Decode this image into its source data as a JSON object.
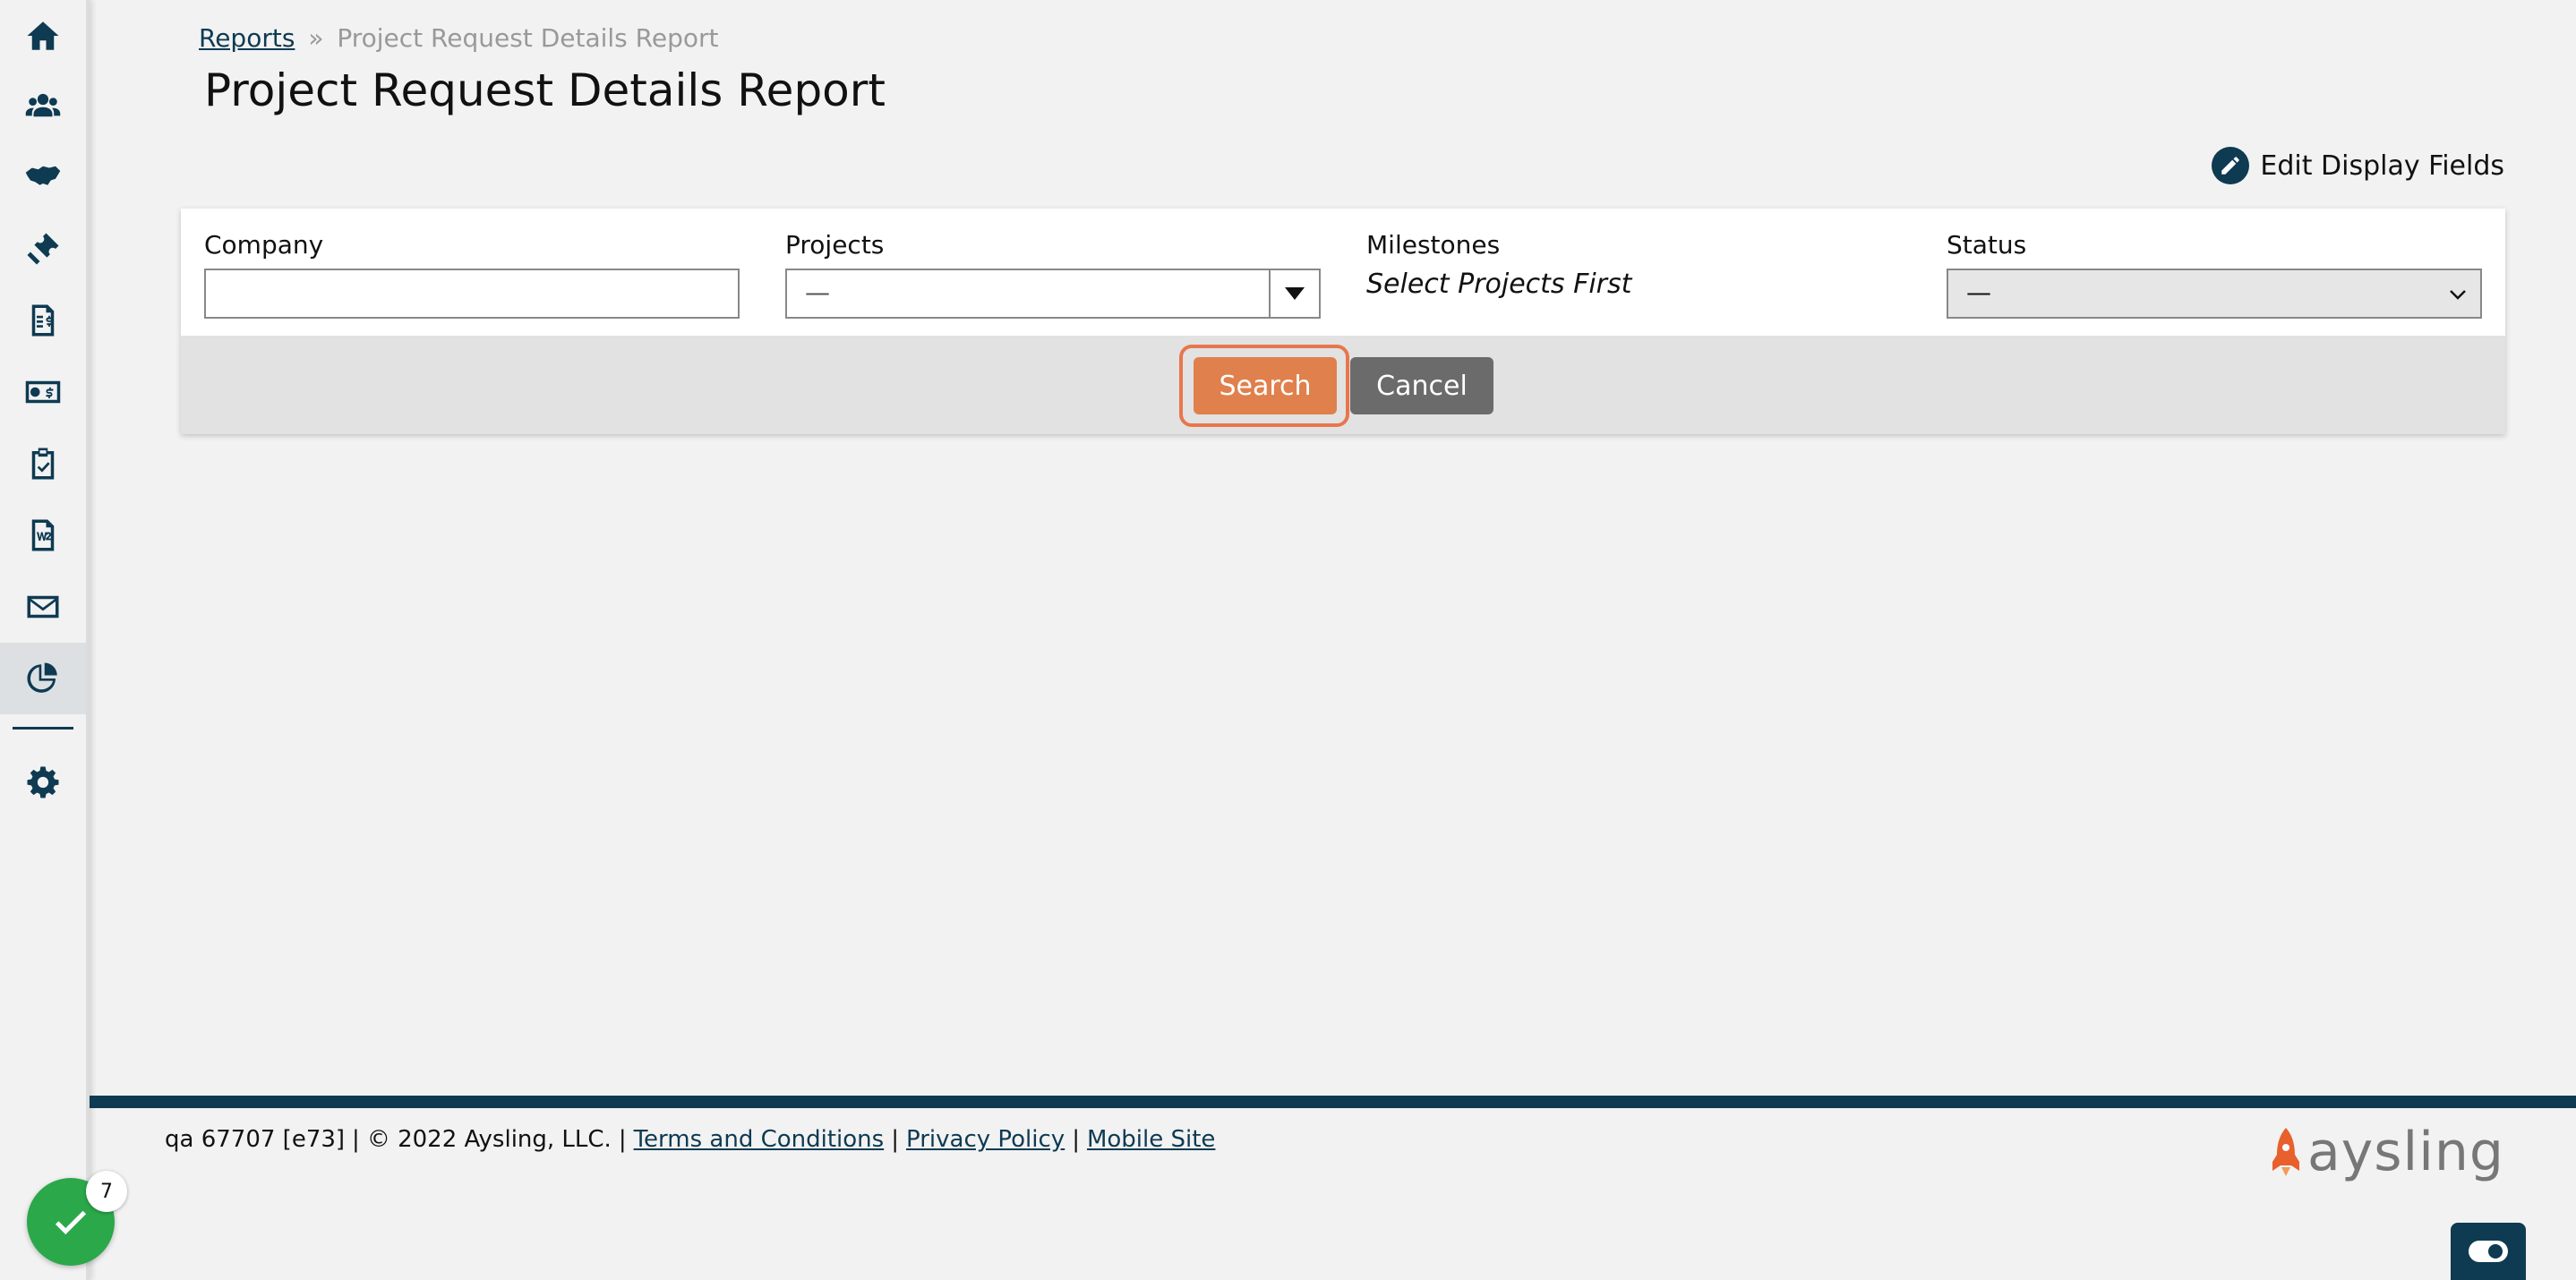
{
  "sidebar": {
    "items": [
      {
        "icon": "home-icon"
      },
      {
        "icon": "people-icon"
      },
      {
        "icon": "handshake-icon"
      },
      {
        "icon": "ticket-icon"
      },
      {
        "icon": "invoice-icon"
      },
      {
        "icon": "money-exchange-icon"
      },
      {
        "icon": "clipboard-check-icon"
      },
      {
        "icon": "w2-document-icon"
      },
      {
        "icon": "mail-icon"
      },
      {
        "icon": "reports-chart-icon",
        "active": true
      },
      {
        "icon": "gear-icon"
      }
    ]
  },
  "breadcrumb": {
    "parent": "Reports",
    "separator": "»",
    "current": "Project Request Details Report"
  },
  "page_title": "Project Request Details Report",
  "edit_display_fields": "Edit Display Fields",
  "filters": {
    "company": {
      "label": "Company",
      "value": ""
    },
    "projects": {
      "label": "Projects",
      "selected": "—"
    },
    "milestones": {
      "label": "Milestones",
      "note": "Select Projects First"
    },
    "status": {
      "label": "Status",
      "selected": "—"
    }
  },
  "actions": {
    "search": "Search",
    "cancel": "Cancel"
  },
  "footer": {
    "build": "qa 67707 [e73]",
    "copyright": "© 2022 Aysling, LLC.",
    "terms": "Terms and Conditions",
    "privacy": "Privacy Policy",
    "mobile": "Mobile Site",
    "logo_text": "aysling"
  },
  "fab": {
    "badge": "7"
  },
  "colors": {
    "navy": "#0e3a52",
    "orange": "#e0804c",
    "green": "#2aa84a",
    "gray_button": "#6b6b6b"
  }
}
